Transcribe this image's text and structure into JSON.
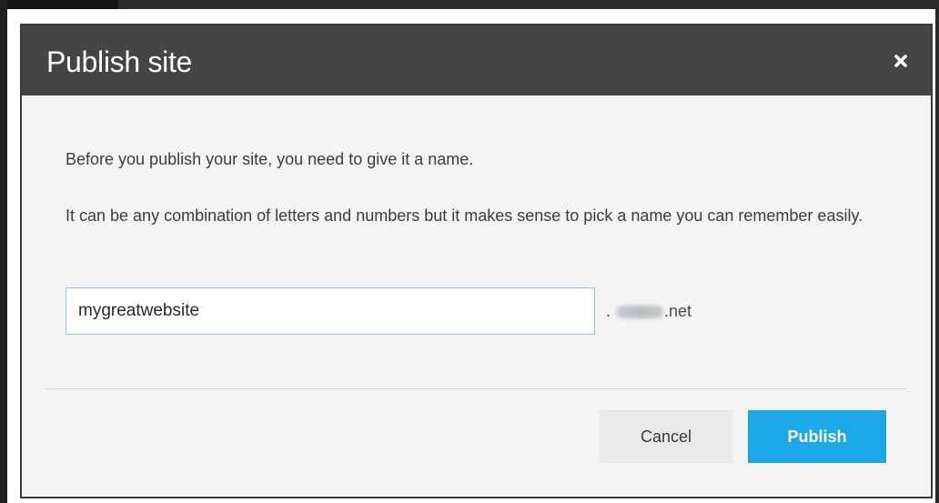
{
  "dialog": {
    "title": "Publish site",
    "close_icon": "close-icon"
  },
  "body": {
    "paragraph1": "Before you publish your site, you need to give it a name.",
    "paragraph2": "It can be any combination of letters and numbers but it makes sense to pick a name you can remember easily."
  },
  "name_field": {
    "value": "mygreatwebsite",
    "domain_prefix": ".",
    "domain_suffix": ".net"
  },
  "actions": {
    "cancel_label": "Cancel",
    "publish_label": "Publish"
  },
  "colors": {
    "header_bg": "#454545",
    "publish_bg": "#1aa8e6",
    "input_border": "#8fc4ea"
  }
}
